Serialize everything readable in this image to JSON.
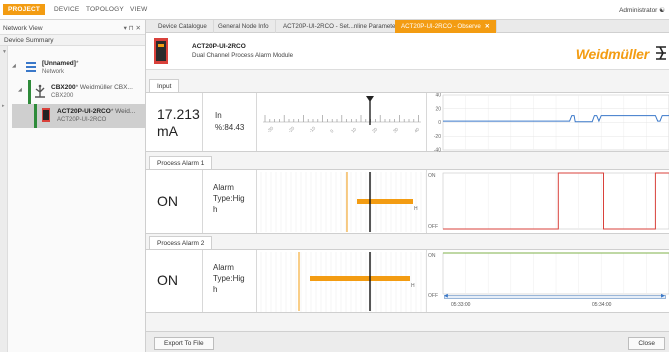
{
  "menu": {
    "items": [
      "PROJECT",
      "DEVICE",
      "TOPOLOGY",
      "VIEW"
    ],
    "user": "Administrator"
  },
  "left_panel": {
    "title": "Network View",
    "controls": "▾ ⊓ ✕",
    "toolbar_label": "Device Summary",
    "tree": [
      {
        "name": "[Unnamed]",
        "suffix": "*",
        "sub": "Network"
      },
      {
        "name": "CBX200",
        "suffix": "* Weidmüller CBX...",
        "sub": "CBX200"
      },
      {
        "name": "ACT20P-UI-2RCO",
        "suffix": "* Weid...",
        "sub": "ACT20P-UI-2RCO"
      }
    ]
  },
  "tabs": [
    "Device Catalogue",
    "General Node Info",
    "ACT20P-UI-2RCO - Set...nline Parameter",
    "ACT20P-UI-2RCO - Observe"
  ],
  "device": {
    "name": "ACT20P-UI-2RCO",
    "description": "Dual Channel Process Alarm Module",
    "logo": "Weidmüller"
  },
  "sections": {
    "input": {
      "tab": "Input",
      "value": "17.213",
      "unit": "mA",
      "label_line1": "In",
      "label_line2": "%:84.43",
      "scale_labels": [
        "-30",
        "-20",
        "-10",
        "0",
        "10",
        "20",
        "30",
        "40"
      ],
      "y_ticks": [
        "40",
        "20",
        "0",
        "-20",
        "-40"
      ]
    },
    "alarm1": {
      "tab": "Process Alarm 1",
      "state": "ON",
      "label_line1": "Alarm",
      "label_line2": "Type:Hig",
      "label_line3": "h",
      "h_marker": "H",
      "on_label": "ON",
      "off_label": "OFF"
    },
    "alarm2": {
      "tab": "Process Alarm 2",
      "state": "ON",
      "label_line1": "Alarm",
      "label_line2": "Type:Hig",
      "label_line3": "h",
      "h_marker": "H",
      "on_label": "ON",
      "off_label": "OFF"
    }
  },
  "chart_data": [
    {
      "type": "line",
      "y_ticks": [
        40,
        20,
        0,
        -20,
        -40
      ],
      "ylim": [
        -40,
        40
      ],
      "series": [
        {
          "color": "#3a78c9",
          "x": [
            0,
            0.56,
            0.57,
            0.58,
            0.585,
            0.59,
            0.66,
            0.67,
            0.68,
            0.69,
            0.7,
            0.72,
            0.94,
            0.95,
            0.96,
            0.97,
            0.98,
            1.0
          ],
          "y": [
            2,
            2,
            10,
            10,
            1,
            1,
            1,
            10,
            10,
            2,
            10,
            10,
            10,
            2,
            2,
            10,
            10,
            10
          ]
        }
      ]
    },
    {
      "type": "line",
      "ylim": [
        "OFF",
        "ON"
      ],
      "series": [
        {
          "color": "#d9413b",
          "x": [
            0,
            0.51,
            0.51,
            0.71,
            0.71,
            0.94,
            0.94,
            1.0
          ],
          "y": [
            0,
            0,
            1,
            1,
            0,
            0,
            1,
            1
          ]
        }
      ]
    },
    {
      "type": "line",
      "ylim": [
        "OFF",
        "ON"
      ],
      "x_ticks": [
        "05:33:00",
        "05:34:00"
      ],
      "series": [
        {
          "color": "#7fb24a",
          "x": [
            0,
            1.0
          ],
          "y": [
            1,
            1
          ]
        }
      ]
    }
  ],
  "footer": {
    "export_label": "Export To File",
    "close_label": "Close"
  },
  "colors": {
    "accent": "#f39c12",
    "green": "#2e8b3a",
    "blue": "#3a78c9",
    "red": "#d9413b"
  }
}
